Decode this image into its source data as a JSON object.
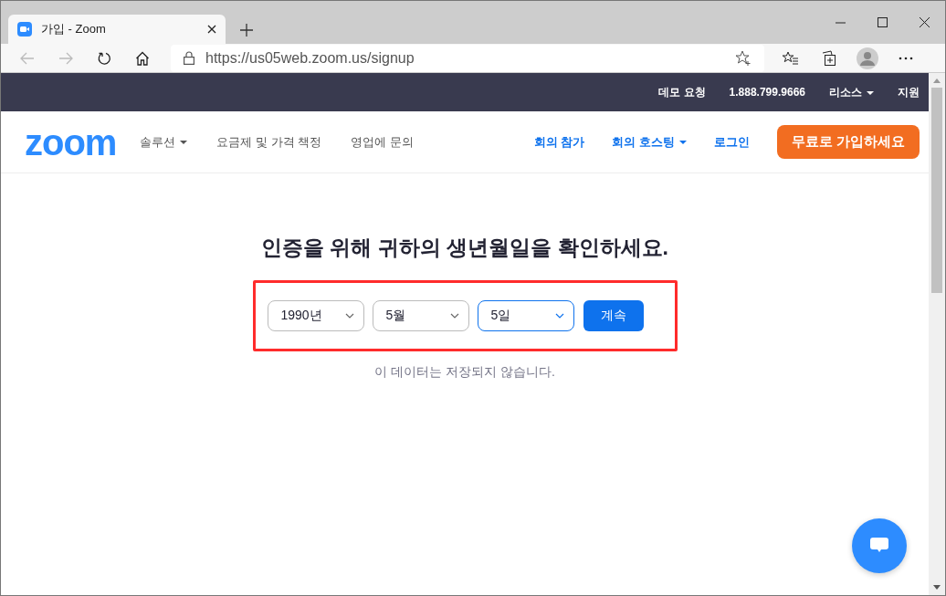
{
  "browser": {
    "tab": {
      "title": "가입 - Zoom",
      "selected": true
    },
    "address": "https://us05web.zoom.us/signup"
  },
  "top_bar": {
    "links": [
      {
        "label": "데모 요청",
        "dropdown": false
      },
      {
        "label": "1.888.799.9666",
        "dropdown": false
      },
      {
        "label": "리소스",
        "dropdown": true
      },
      {
        "label": "지원",
        "dropdown": false
      }
    ]
  },
  "nav": {
    "logo": "zoom",
    "left_links": [
      {
        "label": "솔루션",
        "dropdown": true
      },
      {
        "label": "요금제 및 가격 책정",
        "dropdown": false
      },
      {
        "label": "영업에 문의",
        "dropdown": false
      }
    ],
    "right_links": [
      {
        "label": "회의 참가",
        "dropdown": false
      },
      {
        "label": "회의 호스팅",
        "dropdown": true
      },
      {
        "label": "로그인",
        "dropdown": false
      }
    ],
    "signup_button": "무료로 가입하세요"
  },
  "heading": "인증을 위해 귀하의 생년월일을 확인하세요.",
  "selects": [
    {
      "value": "1990년",
      "focused": false
    },
    {
      "value": "5월",
      "focused": false
    },
    {
      "value": "5일",
      "focused": true
    }
  ],
  "continue_button": "계속",
  "note": "이 데이터는 저장되지 않습니다."
}
